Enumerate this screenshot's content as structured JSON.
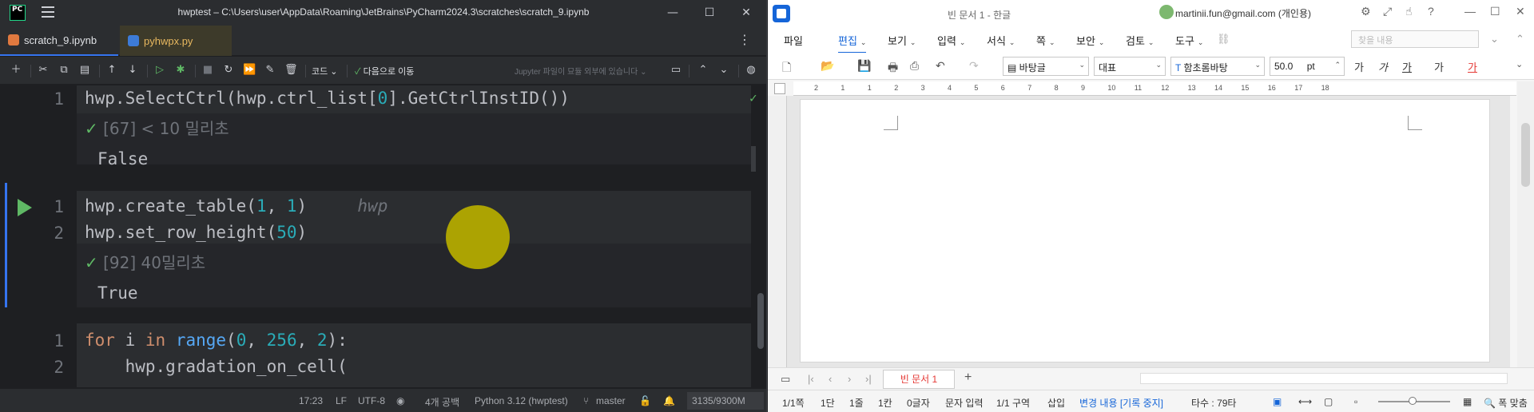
{
  "pycharm": {
    "logo": "PC",
    "window_title": "hwptest – C:\\Users\\user\\AppData\\Roaming\\JetBrains\\PyCharm2024.3\\scratches\\scratch_9.ipynb",
    "tabs": [
      {
        "label": "scratch_9.ipynb",
        "icon": "notebook-icon"
      },
      {
        "label": "pyhwpx.py",
        "icon": "python-file-icon"
      }
    ],
    "toolbar": {
      "code_label": "코드",
      "next_label": "다음으로 이동",
      "jupyter_status": "Jupyter 파일이 묘듈 외부에 있습니다"
    },
    "cells": [
      {
        "line": "1",
        "code": "hwp.SelectCtrl(hwp.ctrl_list[0].GetCtrlInstID())",
        "meta": "[67] < 10 밀리초",
        "output": "False"
      },
      {
        "lines": [
          "1",
          "2"
        ],
        "code1": "hwp.create_table(1, 1)",
        "hint": "hwp",
        "code2": "hwp.set_row_height(50)",
        "meta": "[92] 40밀리초",
        "output": "True"
      },
      {
        "lines": [
          "1",
          "2"
        ],
        "code1": "for i in range(0, 256, 2):",
        "code2": "    hwp.gradation_on_cell("
      }
    ],
    "status": {
      "position": "17:23",
      "line_sep": "LF",
      "encoding": "UTF-8",
      "indent": "4개 공백",
      "interpreter": "Python 3.12 (hwptest)",
      "branch": "master",
      "memory": "3135/9300M"
    }
  },
  "hangul": {
    "window_title": "빈 문서 1 - 한글",
    "account": "martinii.fun@gmail.com (개인용)",
    "menu": [
      {
        "label": "파일"
      },
      {
        "label": "편집"
      },
      {
        "label": "보기"
      },
      {
        "label": "입력"
      },
      {
        "label": "서식"
      },
      {
        "label": "쪽"
      },
      {
        "label": "보안"
      },
      {
        "label": "검토"
      },
      {
        "label": "도구"
      }
    ],
    "find_placeholder": "찾을 내용",
    "format": {
      "style": "바탕글",
      "lang": "대표",
      "font": "함초롬바탕",
      "size": "50.0",
      "unit": "pt"
    },
    "format_buttons": [
      "가",
      "가",
      "가",
      "가",
      "가"
    ],
    "ruler_ticks": [
      "2",
      "1",
      "1",
      "2",
      "3",
      "4",
      "5",
      "6",
      "7",
      "8",
      "9",
      "10",
      "11",
      "12",
      "13",
      "14",
      "15",
      "16",
      "17",
      "18"
    ],
    "sheet_tab": "빈 문서 1",
    "status": {
      "page": "1/1쪽",
      "column": "1단",
      "line": "1줄",
      "col": "1칸",
      "chars": "0글자",
      "mode": "문자 입력",
      "section": "1/1 구역",
      "insert": "삽입",
      "track": "변경 내용 [기록 중지]",
      "typing": "타수 : 79타",
      "fit": "폭 맞춤"
    }
  }
}
